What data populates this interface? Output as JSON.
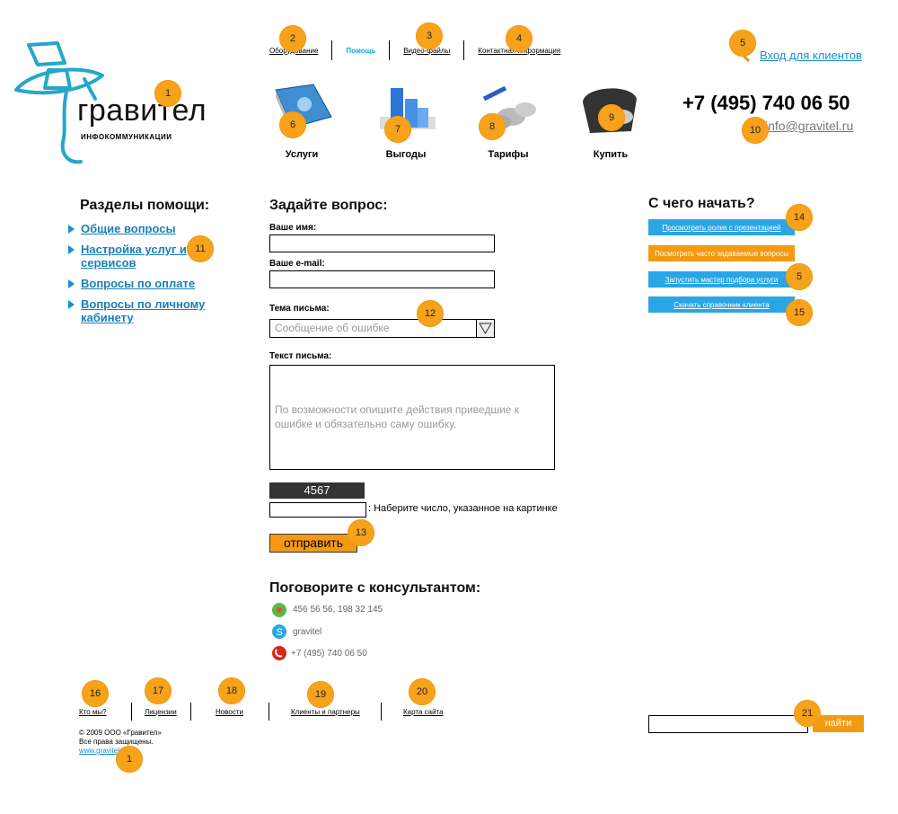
{
  "header": {
    "logo_name": "гравител",
    "logo_sub": "инфокоммуникации",
    "nav": [
      "Оборудование",
      "Помощь",
      "Видео-файлы",
      "Контактная информация"
    ],
    "login_link": "Вход для клиентов",
    "phone": "+7 (495) 740 06 50",
    "email": "info@gravitel.ru"
  },
  "products": [
    "Услуги",
    "Выгоды",
    "Тарифы",
    "Купить"
  ],
  "help": {
    "title": "Разделы помощи:",
    "links": [
      "Общие вопросы",
      "Настройка услуг и сервисов",
      "Вопросы по оплате",
      "Вопросы по личному кабинету"
    ]
  },
  "form": {
    "title": "Задайте вопрос:",
    "name_label": "Ваше имя:",
    "email_label": "Ваше e-mail:",
    "topic_label": "Тема письма:",
    "topic_value": "Сообщение об ошибке",
    "text_label": "Текст письма:",
    "text_placeholder": "По возможности опишите действия приведшие к ошибке и обязательно саму ошибку.",
    "captcha": "4567",
    "captcha_hint": ": Наберите число, указанное на картинке",
    "submit": "отправить"
  },
  "consultant": {
    "title": "Поговорите с консультантом:",
    "icq": "456 56 56, 198 32 145",
    "skype": "gravitel",
    "phone": "+7 (495) 740 06 50"
  },
  "start": {
    "title": "С чего начать?",
    "buttons": [
      "Просмотреть ролик с презентацией",
      "Посмотреть часто задаваемые вопросы",
      "Запустить мастер подбора услуги",
      "Скачать справочник клиента"
    ]
  },
  "footer": {
    "links": [
      "Кто мы?",
      "Лицензии",
      "Новости",
      "Клиенты и партнеры",
      "Карта сайта"
    ],
    "copyright": "© 2009 ООО «Гравител»",
    "rights": "Все права защищены.",
    "site": "www.gravitel.ru",
    "search_button": "найти"
  },
  "markers": [
    "1",
    "2",
    "3",
    "4",
    "5",
    "6",
    "7",
    "8",
    "9",
    "10",
    "11",
    "12",
    "5",
    "14",
    "15",
    "16",
    "17",
    "18",
    "19",
    "20",
    "21",
    "13",
    "1"
  ],
  "colors": {
    "accent_blue": "#2aa5e6",
    "accent_orange": "#f39a12",
    "link_blue": "#1a7fb6",
    "marker": "#f7a21b"
  }
}
